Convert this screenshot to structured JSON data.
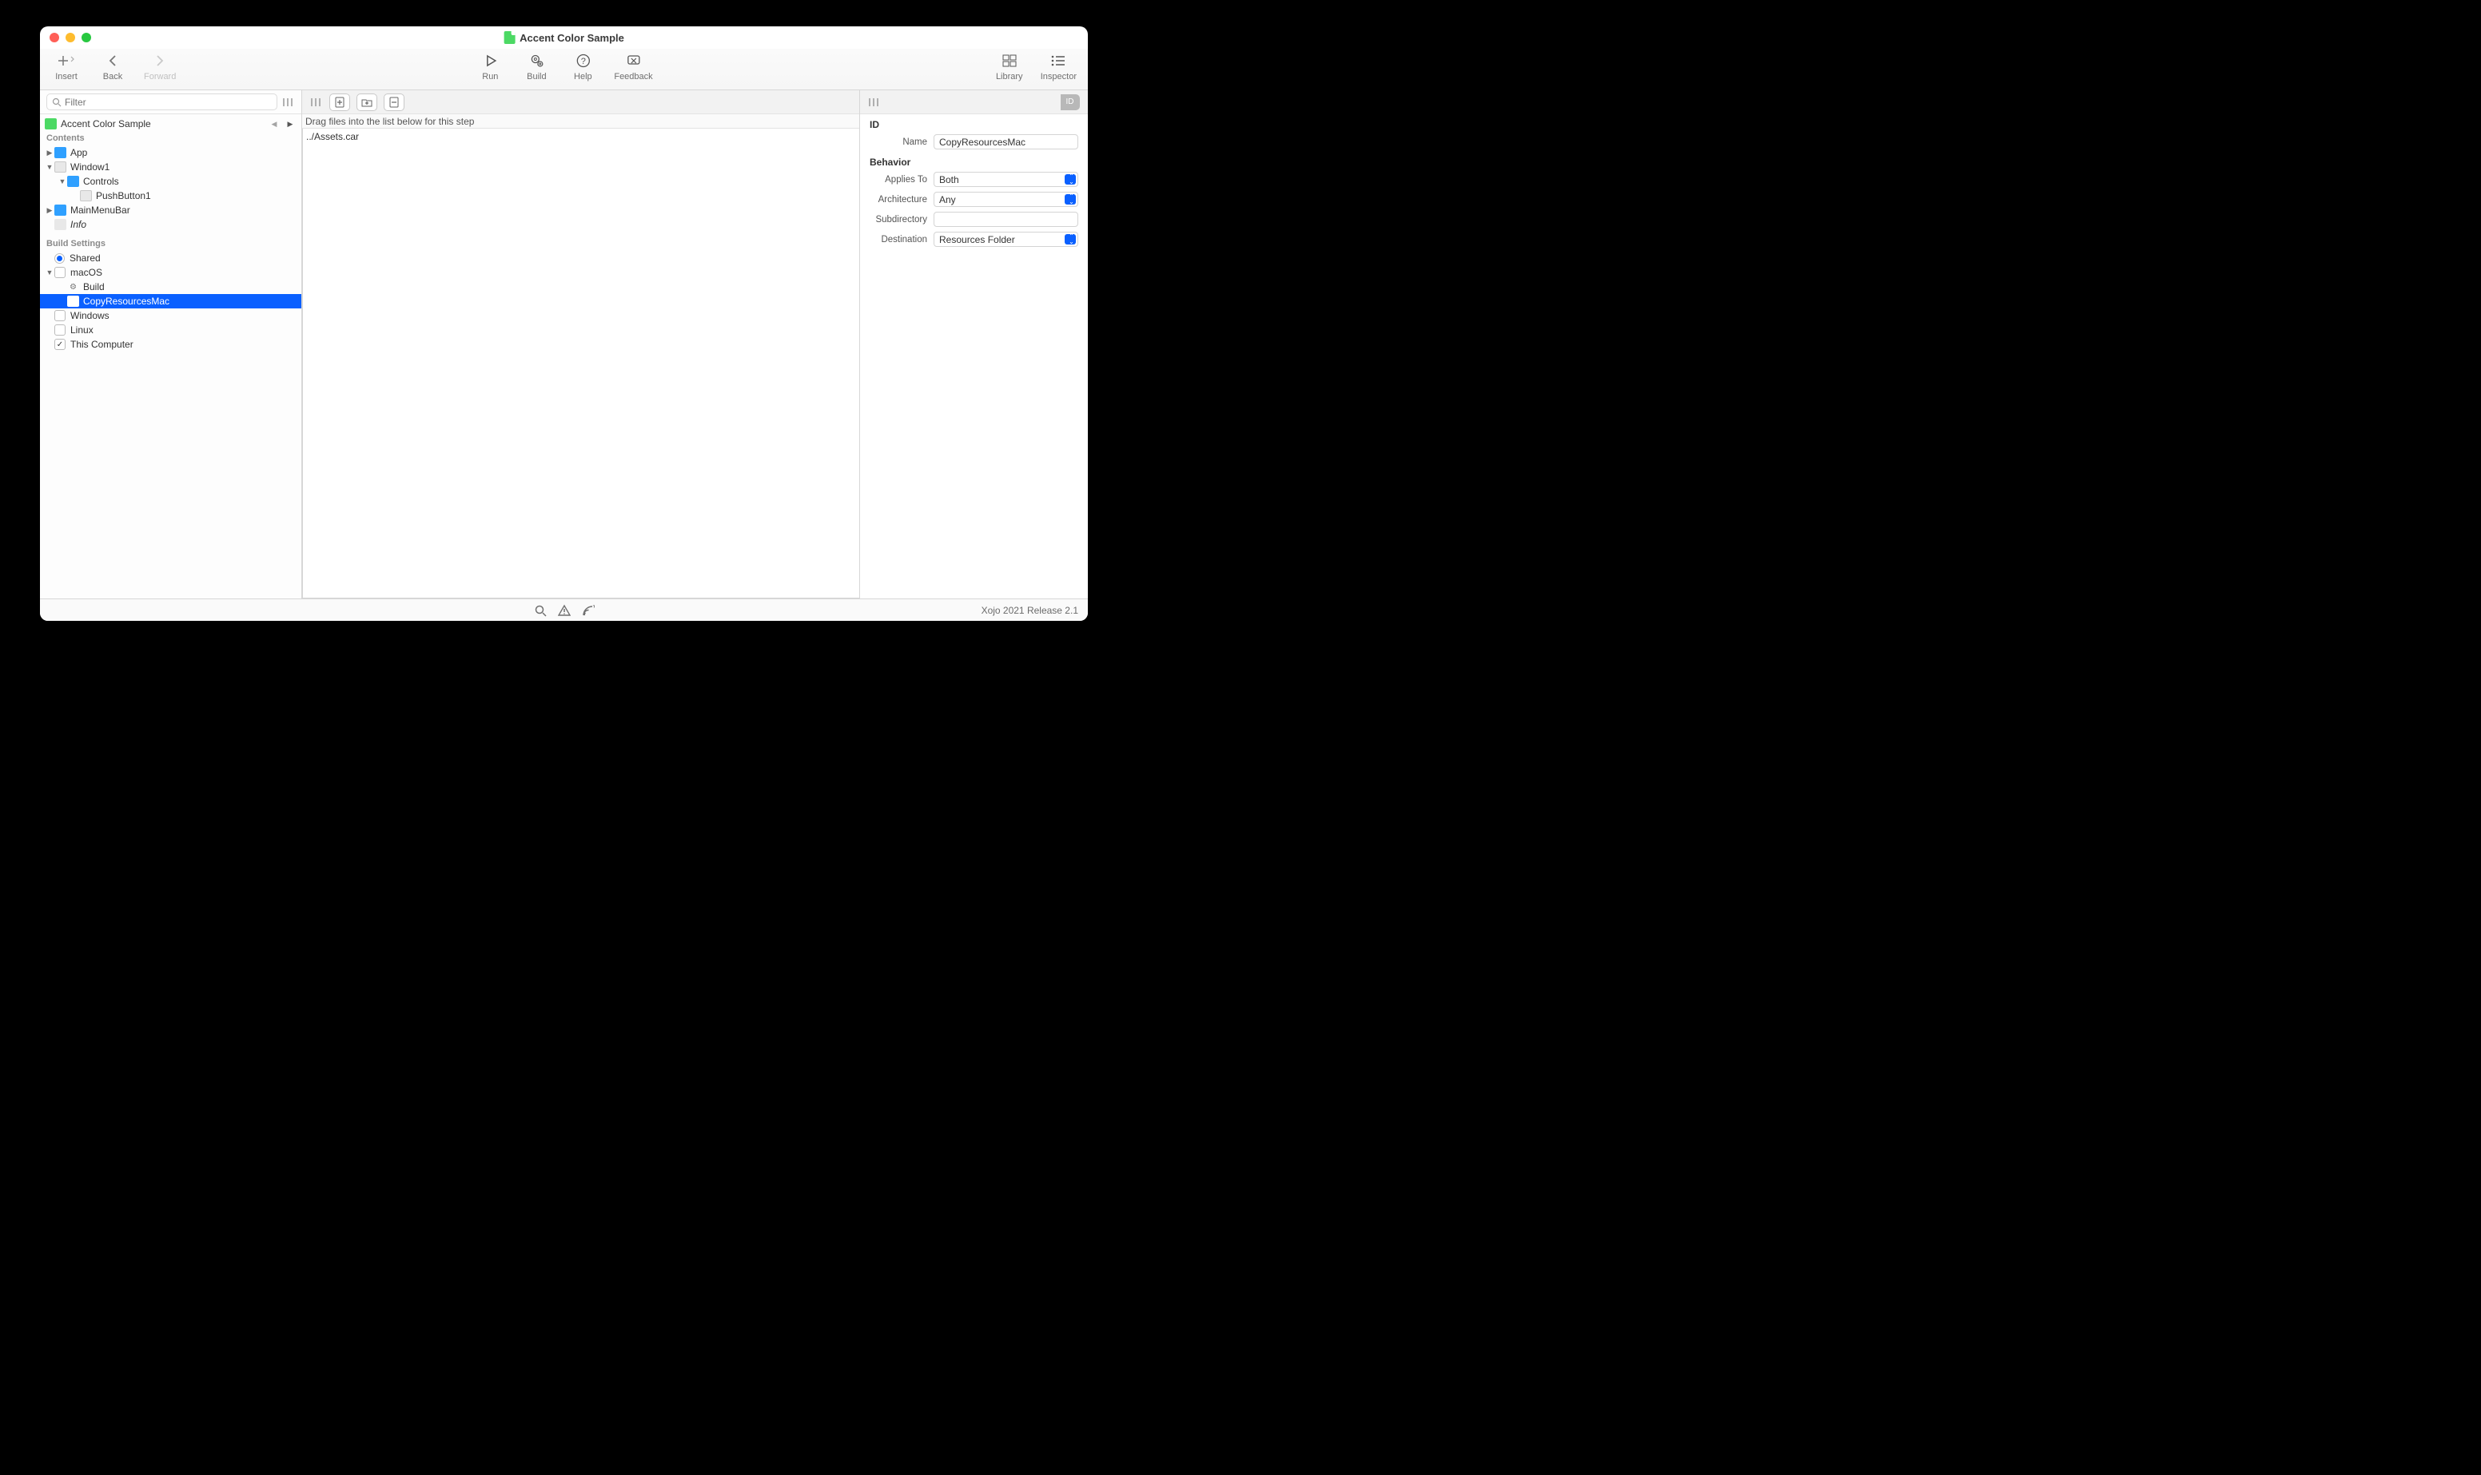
{
  "window": {
    "title": "Accent Color Sample"
  },
  "toolbar": {
    "insert": "Insert",
    "back": "Back",
    "forward": "Forward",
    "run": "Run",
    "build": "Build",
    "help": "Help",
    "feedback": "Feedback",
    "library": "Library",
    "inspector": "Inspector"
  },
  "sidebar": {
    "filter_placeholder": "Filter",
    "project": "Accent Color Sample",
    "contents_label": "Contents",
    "items": {
      "app": "App",
      "window1": "Window1",
      "controls": "Controls",
      "pushbutton1": "PushButton1",
      "mainmenubar": "MainMenuBar",
      "info": "Info"
    },
    "build_settings_label": "Build Settings",
    "build": {
      "shared": "Shared",
      "macos": "macOS",
      "build_step": "Build",
      "copy_resources": "CopyResourcesMac",
      "windows": "Windows",
      "linux": "Linux",
      "this_computer": "This Computer"
    }
  },
  "center": {
    "drag_hint": "Drag files into the list below for this step",
    "files": [
      "../Assets.car"
    ]
  },
  "inspector": {
    "id_label": "ID",
    "name_label": "Name",
    "name_value": "CopyResourcesMac",
    "behavior_label": "Behavior",
    "applies_to_label": "Applies To",
    "applies_to_value": "Both",
    "architecture_label": "Architecture",
    "architecture_value": "Any",
    "subdirectory_label": "Subdirectory",
    "subdirectory_value": "",
    "destination_label": "Destination",
    "destination_value": "Resources Folder"
  },
  "status": {
    "version": "Xojo 2021 Release 2.1"
  }
}
